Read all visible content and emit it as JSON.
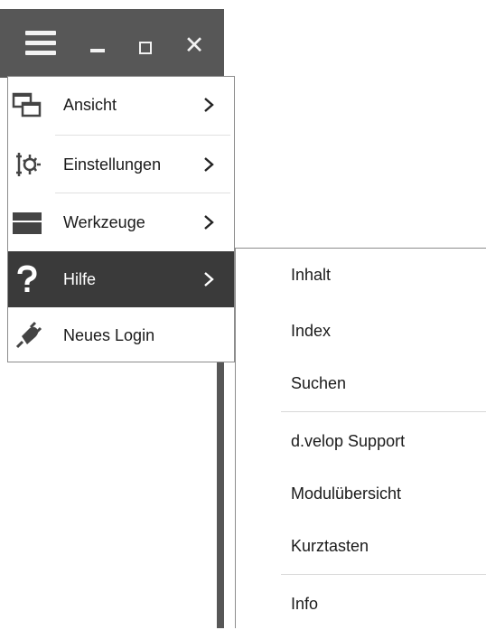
{
  "window": {
    "buttons": [
      "menu",
      "minimize",
      "maximize",
      "close"
    ],
    "close_glyph": "✕"
  },
  "menu": {
    "items": [
      {
        "label": "Ansicht",
        "icon": "windows-icon",
        "has_submenu": true,
        "active": false
      },
      {
        "label": "Einstellungen",
        "icon": "settings-gear-icon",
        "has_submenu": true,
        "active": false
      },
      {
        "label": "Werkzeuge",
        "icon": "toolbox-icon",
        "has_submenu": true,
        "active": false
      },
      {
        "label": "Hilfe",
        "icon": "question-icon",
        "has_submenu": true,
        "active": true
      },
      {
        "label": "Neues Login",
        "icon": "plug-icon",
        "has_submenu": false,
        "active": false
      }
    ],
    "arrow_glyph": "›"
  },
  "submenu": {
    "items": [
      {
        "label": "Inhalt"
      },
      {
        "label": "Index"
      },
      {
        "label": "Suchen"
      },
      {
        "label": "d.velop Support"
      },
      {
        "label": "Modulübersicht"
      },
      {
        "label": "Kurztasten"
      },
      {
        "label": "Info"
      }
    ]
  },
  "colors": {
    "titlebar": "#575757",
    "active_item": "#3a3a3a",
    "border": "#8c8c8c"
  }
}
